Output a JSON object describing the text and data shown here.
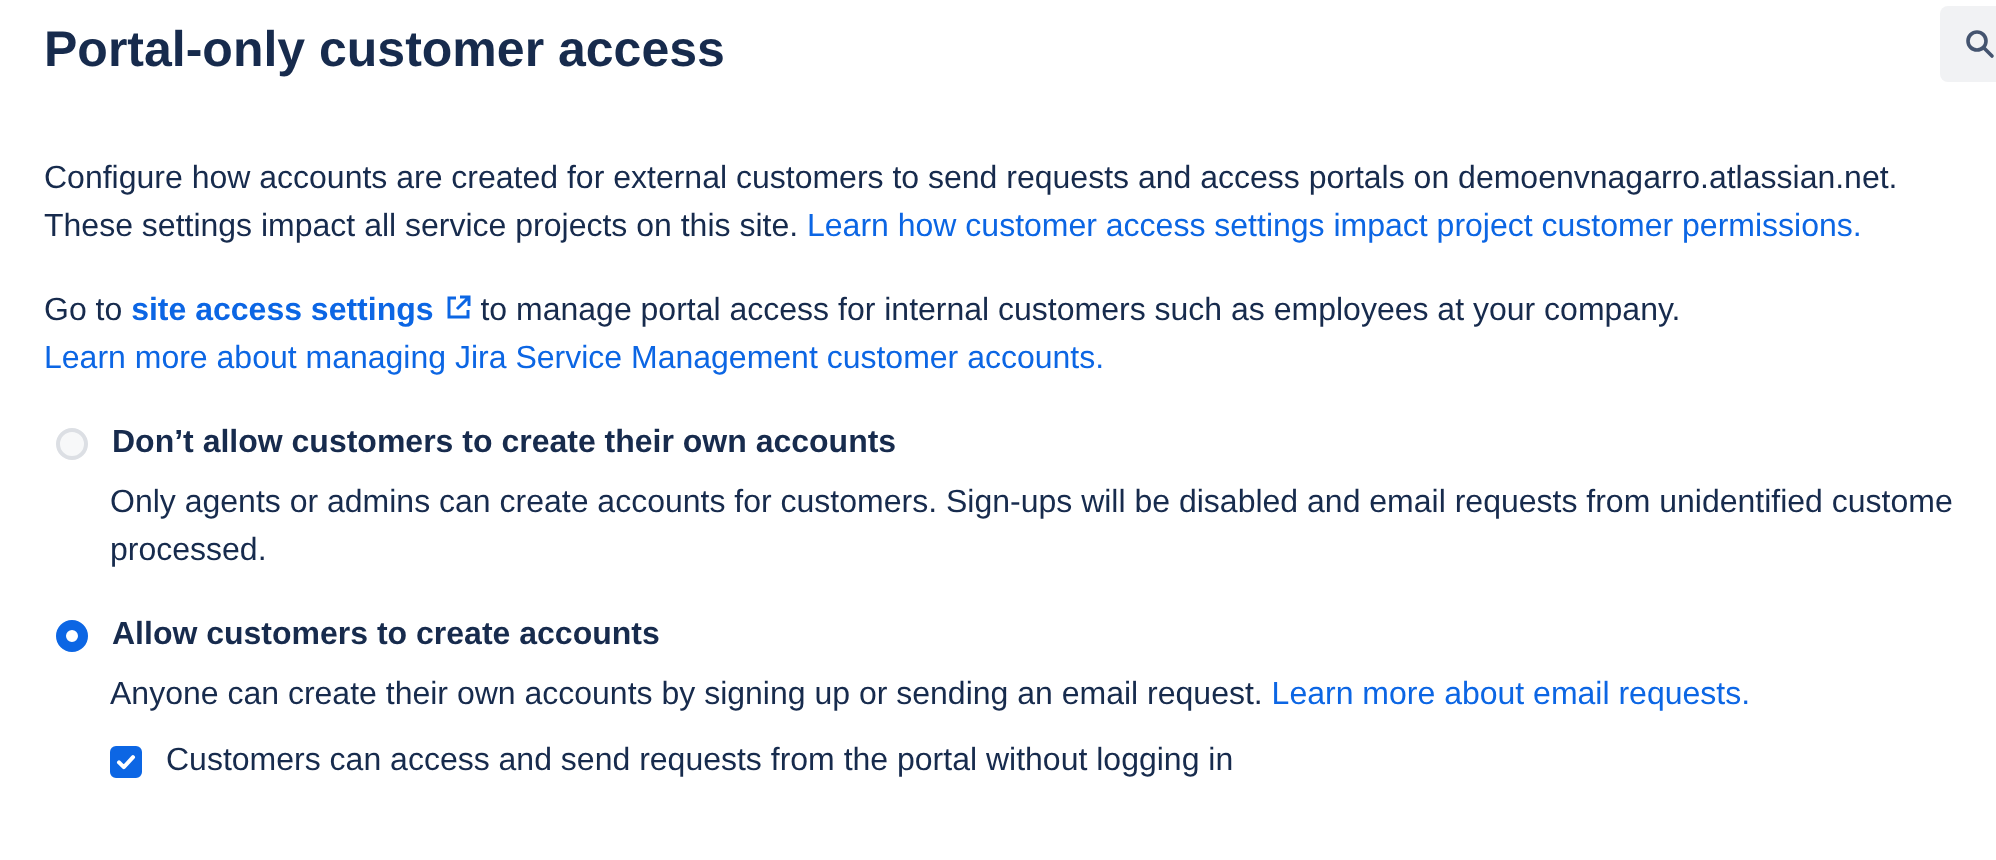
{
  "title": "Portal-only customer access",
  "paragraphs": [
    {
      "lines": [
        [
          {
            "kind": "text",
            "text": "Configure how accounts are created for external customers to send requests and access portals on demoenvnagarro.atlassian.net."
          }
        ],
        [
          {
            "kind": "text",
            "text": "These settings impact all service projects on this site. "
          },
          {
            "kind": "link",
            "text": "Learn how customer access settings impact project customer permissions."
          }
        ]
      ]
    },
    {
      "lines": [
        [
          {
            "kind": "text",
            "text": "Go to "
          },
          {
            "kind": "external-link",
            "text": "site access settings"
          },
          {
            "kind": "text",
            "text": " to manage portal access for internal customers such as employees at your company."
          }
        ],
        [
          {
            "kind": "link",
            "text": "Learn more about managing Jira Service Management customer accounts."
          }
        ]
      ]
    }
  ],
  "options": [
    {
      "label": "Don’t allow customers to create their own accounts",
      "selected": false,
      "description": [
        [
          {
            "kind": "text",
            "text": "Only agents or admins can create accounts for customers. Sign-ups will be disabled and email requests from unidentified custome"
          }
        ],
        [
          {
            "kind": "text",
            "text": "processed."
          }
        ]
      ]
    },
    {
      "label": "Allow customers to create accounts",
      "selected": true,
      "description": [
        [
          {
            "kind": "text",
            "text": "Anyone can create their own accounts by signing up or sending an email request. "
          },
          {
            "kind": "link",
            "text": "Learn more about email requests."
          }
        ]
      ],
      "checkbox": {
        "label": "Customers can access and send requests from the portal without logging in",
        "checked": true
      }
    }
  ]
}
